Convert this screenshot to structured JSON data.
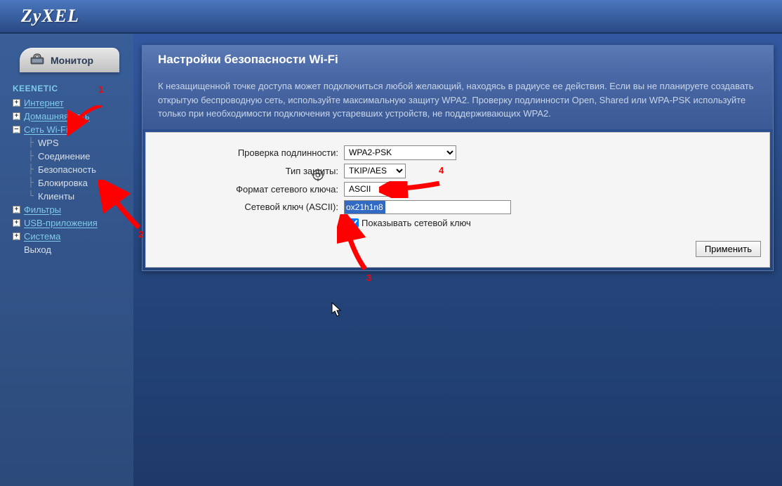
{
  "logo": "ZyXEL",
  "sidebar": {
    "monitor_label": "Монитор",
    "root": "KEENETIC",
    "items": [
      {
        "label": "Интернет",
        "expand": "+"
      },
      {
        "label": "Домашняя сеть",
        "expand": "+"
      },
      {
        "label": "Сеть Wi-Fi",
        "expand": "–",
        "children": [
          "WPS",
          "Соединение",
          "Безопасность",
          "Блокировка",
          "Клиенты"
        ]
      },
      {
        "label": "Фильтры",
        "expand": "+"
      },
      {
        "label": "USB-приложения",
        "expand": "+"
      },
      {
        "label": "Система",
        "expand": "+"
      },
      {
        "label": "Выход",
        "expand": null
      }
    ]
  },
  "panel": {
    "title": "Настройки безопасности Wi-Fi",
    "desc": "К незащищенной точке доступа может подключиться любой желающий, находясь в радиусе ее действия. Если вы не планируете создавать открытую беспроводную сеть, используйте максимальную защиту WPA2. Проверку подлинности Open, Shared или WPA-PSK используйте только при необходимости подключения устаревших устройств, не поддерживающих WPA2.",
    "labels": {
      "auth": "Проверка подлинности:",
      "prot": "Тип защиты:",
      "fmt": "Формат сетевого ключа:",
      "key": "Сетевой ключ (ASCII):",
      "show": "Показывать сетевой ключ"
    },
    "values": {
      "auth": "WPA2-PSK",
      "prot": "TKIP/AES",
      "fmt": "ASCII",
      "key": "ox21h1n8"
    },
    "apply_label": "Применить"
  },
  "annotations": {
    "a1": "1",
    "a2": "2",
    "a3": "3",
    "a4": "4"
  }
}
